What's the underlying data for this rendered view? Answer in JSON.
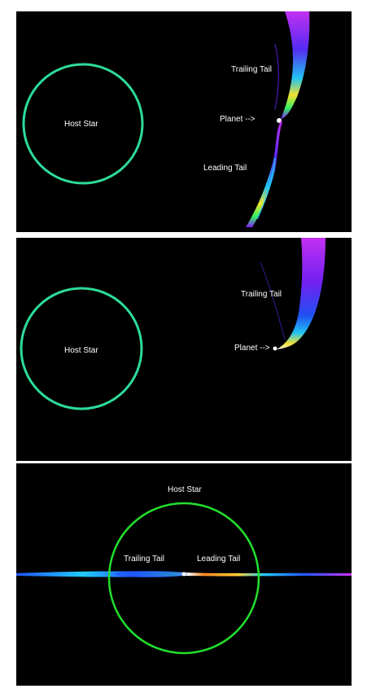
{
  "panels": [
    {
      "host_label": "Host Star",
      "trailing_label": "Trailing Tail",
      "planet_label": "Planet -->",
      "leading_label": "Leading Tail"
    },
    {
      "host_label": "Host Star",
      "trailing_label": "Trailing Tail",
      "planet_label": "Planet -->"
    },
    {
      "host_label": "Host Star",
      "trailing_label": "Trailing Tail",
      "leading_label": "Leading Tail"
    }
  ],
  "colors": {
    "background": "#000000",
    "host_star_outline_top": "#2ddc9a",
    "host_star_outline_bottom": "#22e02c",
    "tail_palette": [
      "#ffffff",
      "#ffee33",
      "#33ff66",
      "#22ccff",
      "#2255ff",
      "#7722ff",
      "#cc33ff"
    ]
  }
}
